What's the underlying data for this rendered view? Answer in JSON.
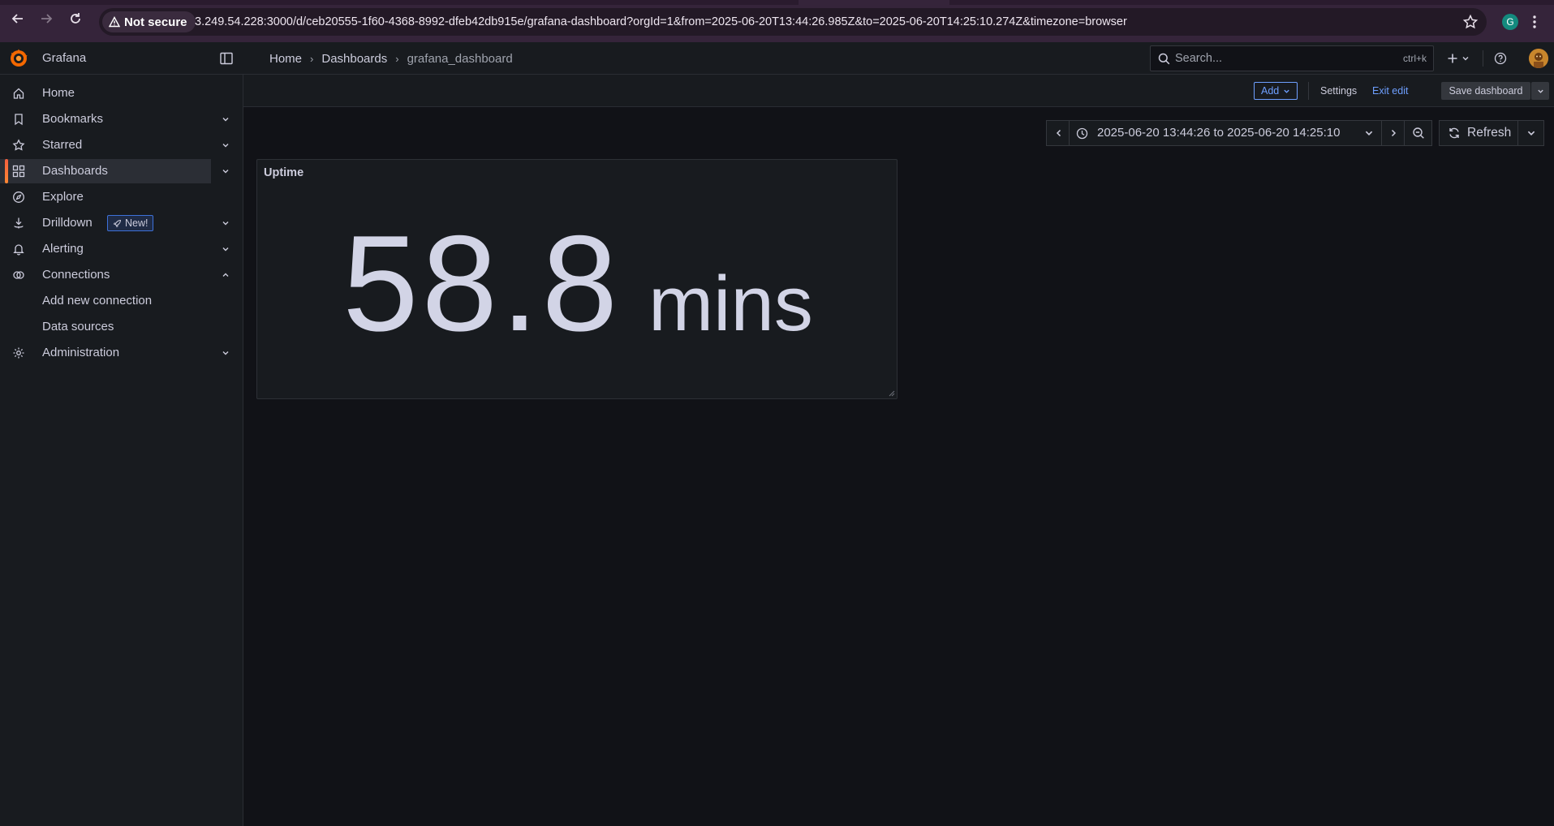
{
  "browser": {
    "security_label": "Not secure",
    "url": "3.249.54.228:3000/d/ceb20555-1f60-4368-8992-dfeb42db915e/grafana-dashboard?orgId=1&from=2025-06-20T13:44:26.985Z&to=2025-06-20T14:25:10.274Z&timezone=browser",
    "profile_initial": "G"
  },
  "topbar": {
    "brand": "Grafana",
    "breadcrumb": [
      "Home",
      "Dashboards",
      "grafana_dashboard"
    ],
    "breadcrumb_sep": "›",
    "search_placeholder": "Search...",
    "search_shortcut": "ctrl+k"
  },
  "sidebar": {
    "items": [
      {
        "label": "Home",
        "icon": "home-icon"
      },
      {
        "label": "Bookmarks",
        "icon": "bookmark-icon",
        "expandable": true
      },
      {
        "label": "Starred",
        "icon": "star-icon",
        "expandable": true
      },
      {
        "label": "Dashboards",
        "icon": "apps-icon",
        "expandable": true,
        "active": true
      },
      {
        "label": "Explore",
        "icon": "compass-icon"
      },
      {
        "label": "Drilldown",
        "icon": "drilldown-icon",
        "expandable": true,
        "badge": "New!"
      },
      {
        "label": "Alerting",
        "icon": "bell-icon",
        "expandable": true
      },
      {
        "label": "Connections",
        "icon": "link-icon",
        "expanded": true
      },
      {
        "label": "Add new connection",
        "sub": true
      },
      {
        "label": "Data sources",
        "sub": true
      },
      {
        "label": "Administration",
        "icon": "gear-icon",
        "expandable": true
      }
    ]
  },
  "editbar": {
    "add_label": "Add",
    "settings_label": "Settings",
    "exit_label": "Exit edit",
    "save_label": "Save dashboard"
  },
  "timepicker": {
    "from": "2025-06-20 13:44:26",
    "to_word": "to",
    "to": "2025-06-20 14:25:10",
    "refresh_label": "Refresh"
  },
  "panel": {
    "title": "Uptime",
    "value": "58.8",
    "unit": "mins"
  },
  "colors": {
    "accent_blue": "#6e9fff",
    "active_bar": "#ff8833",
    "background": "#111217",
    "panel_bg": "#181b1f"
  }
}
